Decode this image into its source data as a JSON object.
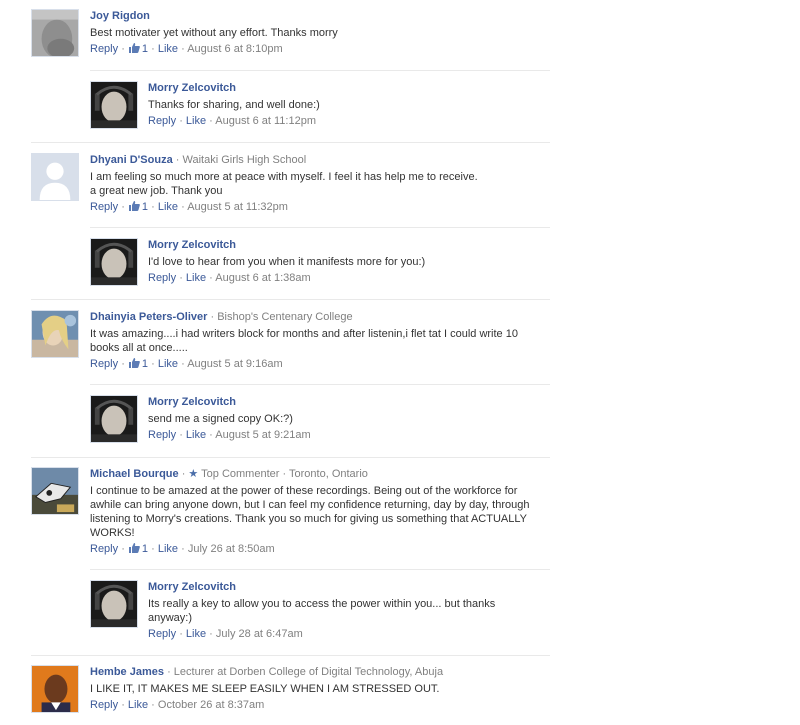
{
  "comments": [
    {
      "author": "Joy Rigdon",
      "affiliation": "",
      "text": "Best motivater yet without any effort. Thanks morry",
      "reply": "Reply",
      "likes": "1",
      "like": "Like",
      "time": "August 6 at 8:10pm",
      "avatar_color": "#9a9a9a",
      "avatar_icon": "avatar-photo-icon"
    },
    {
      "author": "Morry Zelcovitch",
      "affiliation": "",
      "text": "Thanks for sharing, and well done:)",
      "reply": "Reply",
      "like": "Like",
      "time": "August 6 at 11:12pm"
    },
    {
      "author": "Dhyani D'Souza",
      "affiliation": "Waitaki Girls High School",
      "text": "I am feeling so much more at peace with myself. I feel it has help me to receive.\na great new job. Thank you",
      "reply": "Reply",
      "likes": "1",
      "like": "Like",
      "time": "August 5 at 11:32pm"
    },
    {
      "author": "Morry Zelcovitch",
      "affiliation": "",
      "text": "I'd love to hear from you when it manifests more for you:)",
      "reply": "Reply",
      "like": "Like",
      "time": "August 6 at 1:38am"
    },
    {
      "author": "Dhainyia Peters-Oliver",
      "affiliation": "Bishop's Centenary College",
      "text": "It was amazing....i had writers block for months and after listenin,i flet tat I could write 10\nbooks all at once.....",
      "reply": "Reply",
      "likes": "1",
      "like": "Like",
      "time": "August 5 at 9:16am"
    },
    {
      "author": "Morry Zelcovitch",
      "affiliation": "",
      "text": "send me a signed copy OK:?)",
      "reply": "Reply",
      "like": "Like",
      "time": "August 5 at 9:21am"
    },
    {
      "author": "Michael Bourque",
      "affiliation": "Top Commenter",
      "location": "Toronto, Ontario",
      "text": "I continue to be amazed at the power of these recordings. Being out of the workforce for\nawhile can bring anyone down, but I can feel my confidence returning, day by day, through\nlistening to Morry's creations. Thank you so much for giving us something that ACTUALLY\nWORKS!",
      "reply": "Reply",
      "likes": "1",
      "like": "Like",
      "time": "July 26 at 8:50am"
    },
    {
      "author": "Morry Zelcovitch",
      "affiliation": "",
      "text": "Its really a key to allow you to access the power within you... but thanks\nanyway:)",
      "reply": "Reply",
      "like": "Like",
      "time": "July 28 at 6:47am"
    },
    {
      "author": "Hembe James",
      "affiliation": "Lecturer at Dorben College of Digital Technology, Abuja",
      "text": "I LIKE IT, IT MAKES ME SLEEP EASILY WHEN I AM STRESSED OUT.",
      "reply": "Reply",
      "like": "Like",
      "time": "October 26 at 8:37am"
    }
  ],
  "separator": "·",
  "colors": {
    "link": "#3b5998",
    "meta": "#808080",
    "divider": "#e9e9e9"
  }
}
